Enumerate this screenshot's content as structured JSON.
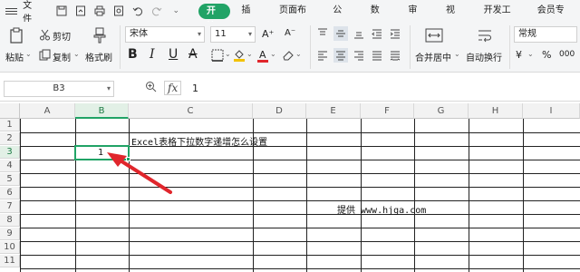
{
  "menubar": {
    "file": "文件",
    "tabs": [
      "开始",
      "插入",
      "页面布局",
      "公式",
      "数据",
      "审阅",
      "视图",
      "开发工具",
      "会员专享"
    ]
  },
  "ribbon": {
    "cut": "剪切",
    "paste": "粘贴",
    "copy": "复制",
    "format_painter": "格式刷",
    "font_name": "宋体",
    "font_size": "11",
    "merge_center": "合并居中",
    "wrap_text": "自动换行",
    "number_format": "常规",
    "currency": "¥",
    "percent": "%",
    "thousands": "000"
  },
  "formula_bar": {
    "cell_ref": "B3",
    "fx": "fx",
    "value": "1"
  },
  "sheet": {
    "columns": [
      "A",
      "B",
      "C",
      "D",
      "E",
      "F",
      "G",
      "H",
      "I"
    ],
    "rows": [
      "1",
      "2",
      "3",
      "4",
      "5",
      "6",
      "7",
      "8",
      "9",
      "10",
      "11"
    ],
    "cells": {
      "C2": "Excel表格下拉数字递增怎么设置",
      "B3": "1",
      "E7": "提供 www.hjga.com"
    },
    "selected_cell": "B3"
  },
  "colors": {
    "accent": "#21a366",
    "arrow": "#e0262c"
  }
}
